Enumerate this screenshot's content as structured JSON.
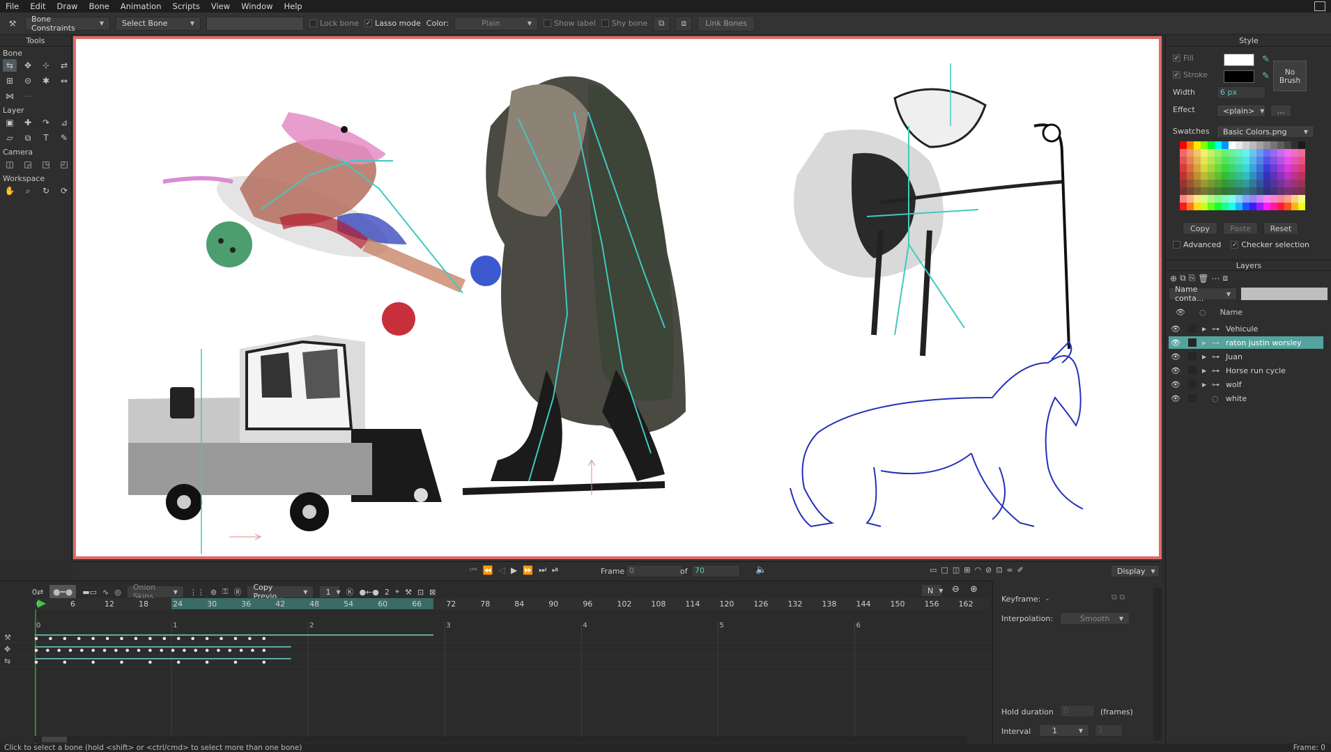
{
  "menu": [
    "File",
    "Edit",
    "Draw",
    "Bone",
    "Animation",
    "Scripts",
    "View",
    "Window",
    "Help"
  ],
  "toolbar": {
    "mode_dropdown": "Bone Constraints",
    "select_dropdown": "Select Bone",
    "lock_bone": "Lock bone",
    "lasso_mode": "Lasso mode",
    "color_label": "Color:",
    "color_dropdown": "Plain",
    "show_label": "Show label",
    "shy_bone": "Shy bone",
    "link_bones": "Link Bones"
  },
  "tools": {
    "title": "Tools",
    "groups": [
      "Bone",
      "Layer",
      "Camera",
      "Workspace"
    ]
  },
  "style_panel": {
    "title": "Style",
    "fill": "Fill",
    "stroke": "Stroke",
    "width_label": "Width",
    "width_value": "6 px",
    "effect_label": "Effect",
    "effect_value": "<plain>",
    "effect_more": "...",
    "no_brush": "No Brush",
    "swatches_label": "Swatches",
    "swatches_value": "Basic Colors.png",
    "copy": "Copy",
    "paste": "Paste",
    "reset": "Reset",
    "advanced": "Advanced",
    "checker_selection": "Checker selection"
  },
  "layers_panel": {
    "title": "Layers",
    "filter_dropdown": "Name conta...",
    "col_name": "Name",
    "layers": [
      {
        "name": "Vehicule",
        "selected": false
      },
      {
        "name": "raton justin worsley",
        "selected": true
      },
      {
        "name": "Juan",
        "selected": false
      },
      {
        "name": "Horse run cycle",
        "selected": false
      },
      {
        "name": "wolf",
        "selected": false
      },
      {
        "name": "white",
        "selected": false
      }
    ]
  },
  "playback": {
    "frame_label": "Frame",
    "frame_value": "0",
    "of_label": "of",
    "total_frames": "70",
    "display": "Display"
  },
  "timeline": {
    "onion_skins": "Onion Skins",
    "copy_previous": "Copy Previo...",
    "step_value": "1",
    "key_count": "2",
    "n_label": "N",
    "ruler": [
      "0",
      "6",
      "12",
      "18",
      "24",
      "30",
      "36",
      "42",
      "48",
      "54",
      "60",
      "66",
      "72",
      "78",
      "84",
      "90",
      "96",
      "102",
      "108",
      "114",
      "120",
      "126",
      "132",
      "138",
      "144",
      "150",
      "156",
      "162"
    ],
    "seconds": [
      "0",
      "1",
      "2",
      "3",
      "4",
      "5",
      "6"
    ]
  },
  "keyframe_panel": {
    "keyframe_label": "Keyframe:",
    "keyframe_value": "-",
    "interpolation_label": "Interpolation:",
    "interpolation_value": "Smooth",
    "hold_label": "Hold duration",
    "hold_value": "0",
    "frames_label": "(frames)",
    "interval_label": "Interval",
    "interval_value": "1",
    "interval_field": "1"
  },
  "status": {
    "message": "Click to select a bone (hold <shift> or <ctrl/cmd> to select more than one bone)",
    "frame": "Frame: 0"
  },
  "colors": {
    "accent": "#54a39d",
    "canvas_border": "#e06a6a",
    "bone": "#3fc9c0",
    "horse": "#2230b8"
  }
}
